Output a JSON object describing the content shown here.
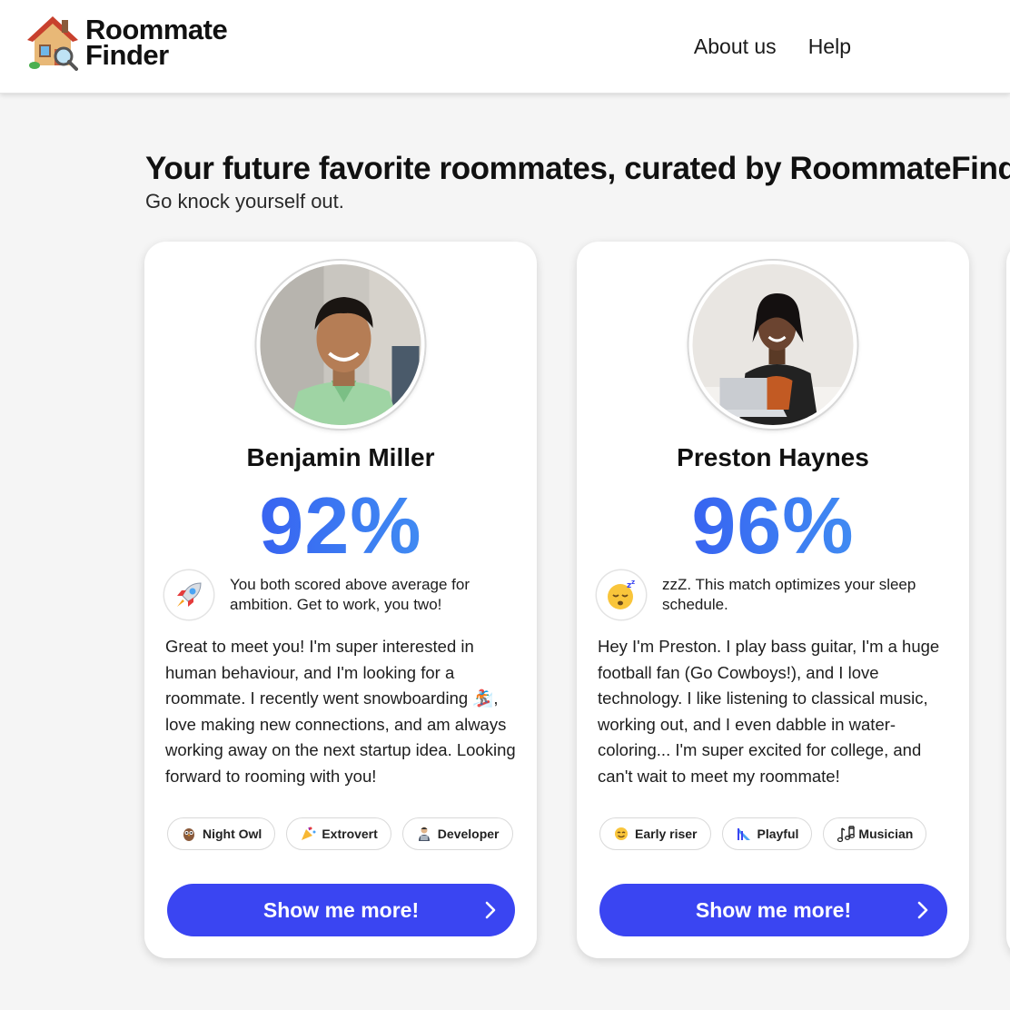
{
  "app": {
    "logo_line1": "Roommate",
    "logo_line2": "Finder",
    "nav": [
      "About us",
      "Help"
    ]
  },
  "page": {
    "title": "Your future favorite roommates, curated by RoommateFinder",
    "subtitle": "Go knock yourself out."
  },
  "cards": [
    {
      "name": "Benjamin Miller",
      "match_percent": "92%",
      "match_icon": "rocket-icon",
      "match_text": "You both scored above average for ambition. Get to work, you two!",
      "bio": "Great to meet you! I'm super interested in human behaviour, and I'm looking for a roommate. I recently went snowboarding 🏂, love making new connections, and am always working away on the next startup idea. Looking forward to rooming with you!",
      "tags": [
        {
          "icon": "owl-icon",
          "label": "Night Owl"
        },
        {
          "icon": "party-popper-icon",
          "label": "Extrovert"
        },
        {
          "icon": "developer-icon",
          "label": "Developer"
        }
      ],
      "button_label": "Show me more!"
    },
    {
      "name": "Preston Haynes",
      "match_percent": "96%",
      "match_icon": "sleeping-face-icon",
      "match_text": "zzZ. This match optimizes your sleep schedule.",
      "bio": "Hey I'm Preston. I play bass guitar, I'm a huge football fan (Go Cowboys!), and I love technology. I like listening to classical music, working out, and I even dabble in water-coloring... I'm super excited for college, and can't wait to meet my roommate!",
      "tags": [
        {
          "icon": "smiley-icon",
          "label": "Early riser"
        },
        {
          "icon": "slide-icon",
          "label": "Playful"
        },
        {
          "icon": "music-notes-icon",
          "label": "Musician"
        }
      ],
      "button_label": "Show me more!"
    }
  ],
  "colors": {
    "accent": "#3a45f2",
    "percent_gradient": [
      "#3346f0",
      "#4aa4f4"
    ],
    "background": "#f5f5f5"
  }
}
